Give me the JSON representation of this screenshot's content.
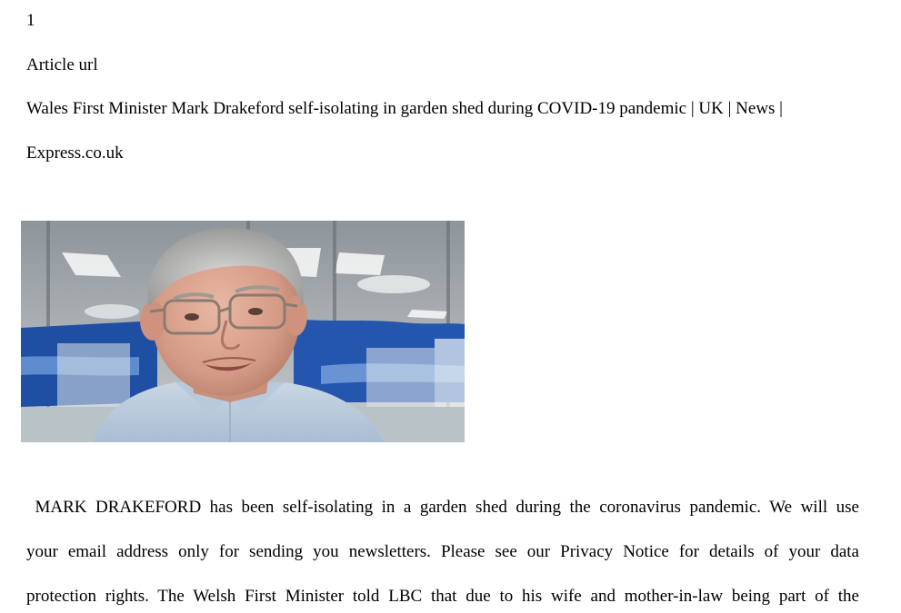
{
  "page_number": "1",
  "label": "Article url",
  "article_title": {
    "line1": "Wales First Minister Mark Drakeford self-isolating in garden shed during COVID-19 pandemic | UK | News |",
    "line2": "Express.co.uk"
  },
  "body": {
    "line1": " MARK DRAKEFORD has been self-isolating in a garden shed during the coronavirus pandemic. We will use",
    "line2": "your email address only for sending you newsletters. Please see our Privacy Notice for details of your data",
    "line3": "protection rights. The Welsh First Minister told LBC that due to his wife and mother-in-law being part of the"
  }
}
